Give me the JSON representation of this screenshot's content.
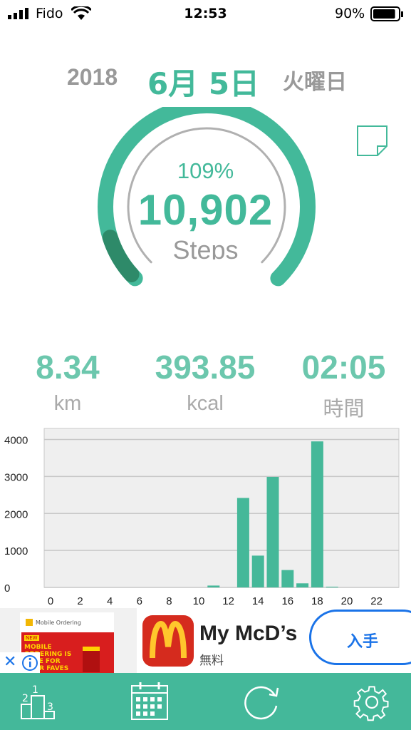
{
  "status_bar": {
    "carrier": "Fido",
    "time": "12:53",
    "battery": "90%",
    "battery_level": 0.9
  },
  "date": {
    "year": "2018",
    "month_day": "6月 5日",
    "weekday": "火曜日"
  },
  "gauge": {
    "percent_label": "109%",
    "steps_value": "10,902",
    "steps_label": "Steps",
    "progress_fraction": 1.09,
    "accent_color": "#43b99a",
    "dark_color": "#2e8a69"
  },
  "stats": [
    {
      "value": "8.34",
      "unit": "km"
    },
    {
      "value": "393.85",
      "unit": "kcal"
    },
    {
      "value": "02:05",
      "unit": "時間"
    }
  ],
  "chart_data": {
    "type": "bar",
    "x": [
      0,
      1,
      2,
      3,
      4,
      5,
      6,
      7,
      8,
      9,
      10,
      11,
      12,
      13,
      14,
      15,
      16,
      17,
      18,
      19,
      20,
      21,
      22,
      23
    ],
    "values": [
      0,
      0,
      0,
      0,
      0,
      0,
      0,
      0,
      0,
      0,
      0,
      50,
      0,
      2420,
      860,
      2990,
      470,
      110,
      3950,
      20,
      0,
      0,
      0,
      0
    ],
    "xticks": [
      "0",
      "2",
      "4",
      "6",
      "8",
      "10",
      "12",
      "14",
      "16",
      "18",
      "20",
      "22"
    ],
    "yticks": [
      "0",
      "1000",
      "2000",
      "3000",
      "4000"
    ],
    "ylim": [
      0,
      4300
    ],
    "grid": true,
    "bar_color": "#45b899"
  },
  "ad": {
    "title": "My McD’s",
    "subtitle": "無料",
    "button_label": "入手",
    "thumb_header": "Mobile Ordering",
    "thumb_text": "MOBILE ORDERING IS HERE FOR YOUR FAVES",
    "thumb_badge": "NEW"
  },
  "tabbar": {
    "items": [
      {
        "icon": "ranking-icon"
      },
      {
        "icon": "calendar-icon"
      },
      {
        "icon": "refresh-icon"
      },
      {
        "icon": "gear-icon"
      }
    ]
  }
}
